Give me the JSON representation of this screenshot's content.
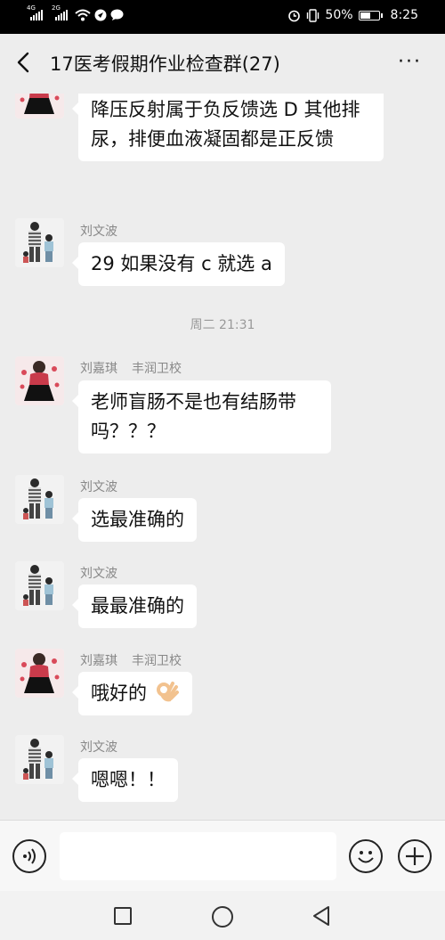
{
  "status_bar": {
    "signal1": "4G",
    "signal2": "2G",
    "battery": "50%",
    "battery_level": 0.5,
    "time": "8:25",
    "icons": [
      "wifi-icon",
      "location-icon",
      "message-icon",
      "alarm-icon",
      "vibrate-icon",
      "battery-icon"
    ]
  },
  "header": {
    "title": "17医考假期作业检查群(27)",
    "more": "···"
  },
  "messages": [
    {
      "text": "降压反射属于负反馈选 D 其他排尿，排便血液凝固都是正反馈"
    },
    {
      "sender": "刘文波",
      "text": "29 如果没有 c 就选 a"
    },
    {
      "time": "周二 21:31"
    },
    {
      "sender": "刘嘉琪",
      "sender_extra": "丰润卫校",
      "text": "老师盲肠不是也有结肠带吗？？？"
    },
    {
      "sender": "刘文波",
      "text": "选最准确的"
    },
    {
      "sender": "刘文波",
      "text": "最最准确的"
    },
    {
      "sender": "刘嘉琪",
      "sender_extra": "丰润卫校",
      "text": "哦好的"
    },
    {
      "sender": "刘文波",
      "text": "嗯嗯！！"
    }
  ],
  "colors": {
    "background": "#ededed",
    "bubble": "#ffffff",
    "meta_text": "#888888"
  }
}
